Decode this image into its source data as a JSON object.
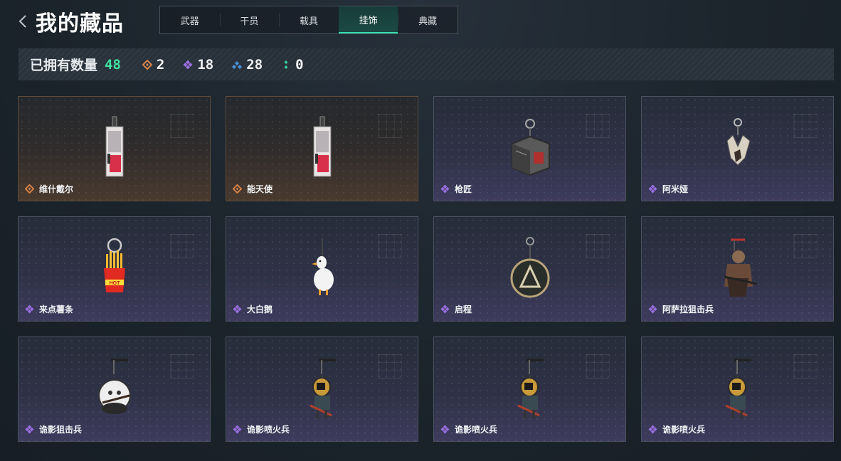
{
  "header": {
    "title": "我的藏品",
    "tabs": [
      {
        "label": "武器",
        "active": false
      },
      {
        "label": "干员",
        "active": false
      },
      {
        "label": "载具",
        "active": false
      },
      {
        "label": "挂饰",
        "active": true
      },
      {
        "label": "典藏",
        "active": false
      }
    ]
  },
  "summary": {
    "label": "已拥有数量",
    "total": "48",
    "stats": [
      {
        "icon": "gold-rarity-icon",
        "value": "2"
      },
      {
        "icon": "purple-rarity-icon",
        "value": "18"
      },
      {
        "icon": "blue-rarity-icon",
        "value": "28"
      },
      {
        "icon": "green-rarity-icon",
        "value": "0"
      }
    ]
  },
  "items": [
    {
      "name": "维什戴尔",
      "rarity": "gold",
      "art": "card-charm"
    },
    {
      "name": "能天使",
      "rarity": "gold",
      "art": "card-charm"
    },
    {
      "name": "枪匠",
      "rarity": "purple",
      "art": "box-charm"
    },
    {
      "name": "阿米娅",
      "rarity": "purple",
      "art": "bunny-charm"
    },
    {
      "name": "来点薯条",
      "rarity": "purple",
      "art": "fries-charm"
    },
    {
      "name": "大白鹅",
      "rarity": "purple",
      "art": "goose-charm"
    },
    {
      "name": "启程",
      "rarity": "purple",
      "art": "medal-charm"
    },
    {
      "name": "阿萨拉狙击兵",
      "rarity": "purple",
      "art": "sniper-charm"
    },
    {
      "name": "诡影狙击兵",
      "rarity": "purple",
      "art": "ghost-sniper-charm"
    },
    {
      "name": "诡影喷火兵",
      "rarity": "purple",
      "art": "flamer-charm"
    },
    {
      "name": "诡影喷火兵",
      "rarity": "purple",
      "art": "flamer-charm"
    },
    {
      "name": "诡影喷火兵",
      "rarity": "purple",
      "art": "flamer-charm"
    }
  ],
  "colors": {
    "accent": "#3fe2a0",
    "gold": "#d9854a",
    "purple": "#9a6ee0",
    "blue": "#4a8fe0",
    "green": "#35d0a0"
  }
}
